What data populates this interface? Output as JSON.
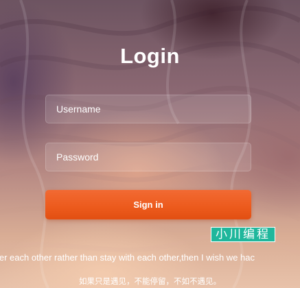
{
  "login": {
    "title": "Login",
    "username_placeholder": "Username",
    "password_placeholder": "Password",
    "signin_label": "Sign in"
  },
  "watermark": {
    "text": "小川编程"
  },
  "quotes": {
    "english": "ater each other rather than stay with each other,then I wish we hac",
    "chinese": "如果只是遇见，不能停留，不如不遇见。"
  },
  "colors": {
    "signin_button": "#ec5a1c",
    "watermark_bg": "#1fb79c",
    "text": "#ffffff"
  }
}
